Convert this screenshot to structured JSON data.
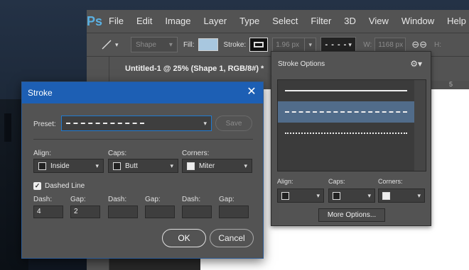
{
  "app": {
    "logo": "Ps",
    "menu": [
      "File",
      "Edit",
      "Image",
      "Layer",
      "Type",
      "Select",
      "Filter",
      "3D",
      "View",
      "Window",
      "Help"
    ]
  },
  "options_bar": {
    "shape_mode": "Shape",
    "fill_label": "Fill:",
    "fill_color": "#a8c7df",
    "stroke_label": "Stroke:",
    "stroke_width": "1.96 px",
    "w_label": "W:",
    "w_value": "1168 px",
    "h_label": "H:"
  },
  "document": {
    "tab_title": "Untitled-1 @ 25% (Shape 1, RGB/8#) *",
    "ruler_mark": "5"
  },
  "stroke_options_panel": {
    "title": "Stroke Options",
    "line_styles": [
      "solid",
      "dashed",
      "dotted"
    ],
    "selected_style": "dashed",
    "align_label": "Align:",
    "caps_label": "Caps:",
    "corners_label": "Corners:",
    "more_options": "More Options..."
  },
  "stroke_dialog": {
    "title": "Stroke",
    "preset_label": "Preset:",
    "save_label": "Save",
    "align_label": "Align:",
    "align_value": "Inside",
    "caps_label": "Caps:",
    "caps_value": "Butt",
    "corners_label": "Corners:",
    "corners_value": "Miter",
    "dashed_line_label": "Dashed Line",
    "dashed_line_checked": true,
    "dash_gap": [
      {
        "dash_label": "Dash:",
        "dash_value": "4",
        "gap_label": "Gap:",
        "gap_value": "2"
      },
      {
        "dash_label": "Dash:",
        "dash_value": "",
        "gap_label": "Gap:",
        "gap_value": ""
      },
      {
        "dash_label": "Dash:",
        "dash_value": "",
        "gap_label": "Gap:",
        "gap_value": ""
      }
    ],
    "ok_label": "OK",
    "cancel_label": "Cancel",
    "title_bar_color": "#1d5fb4"
  }
}
